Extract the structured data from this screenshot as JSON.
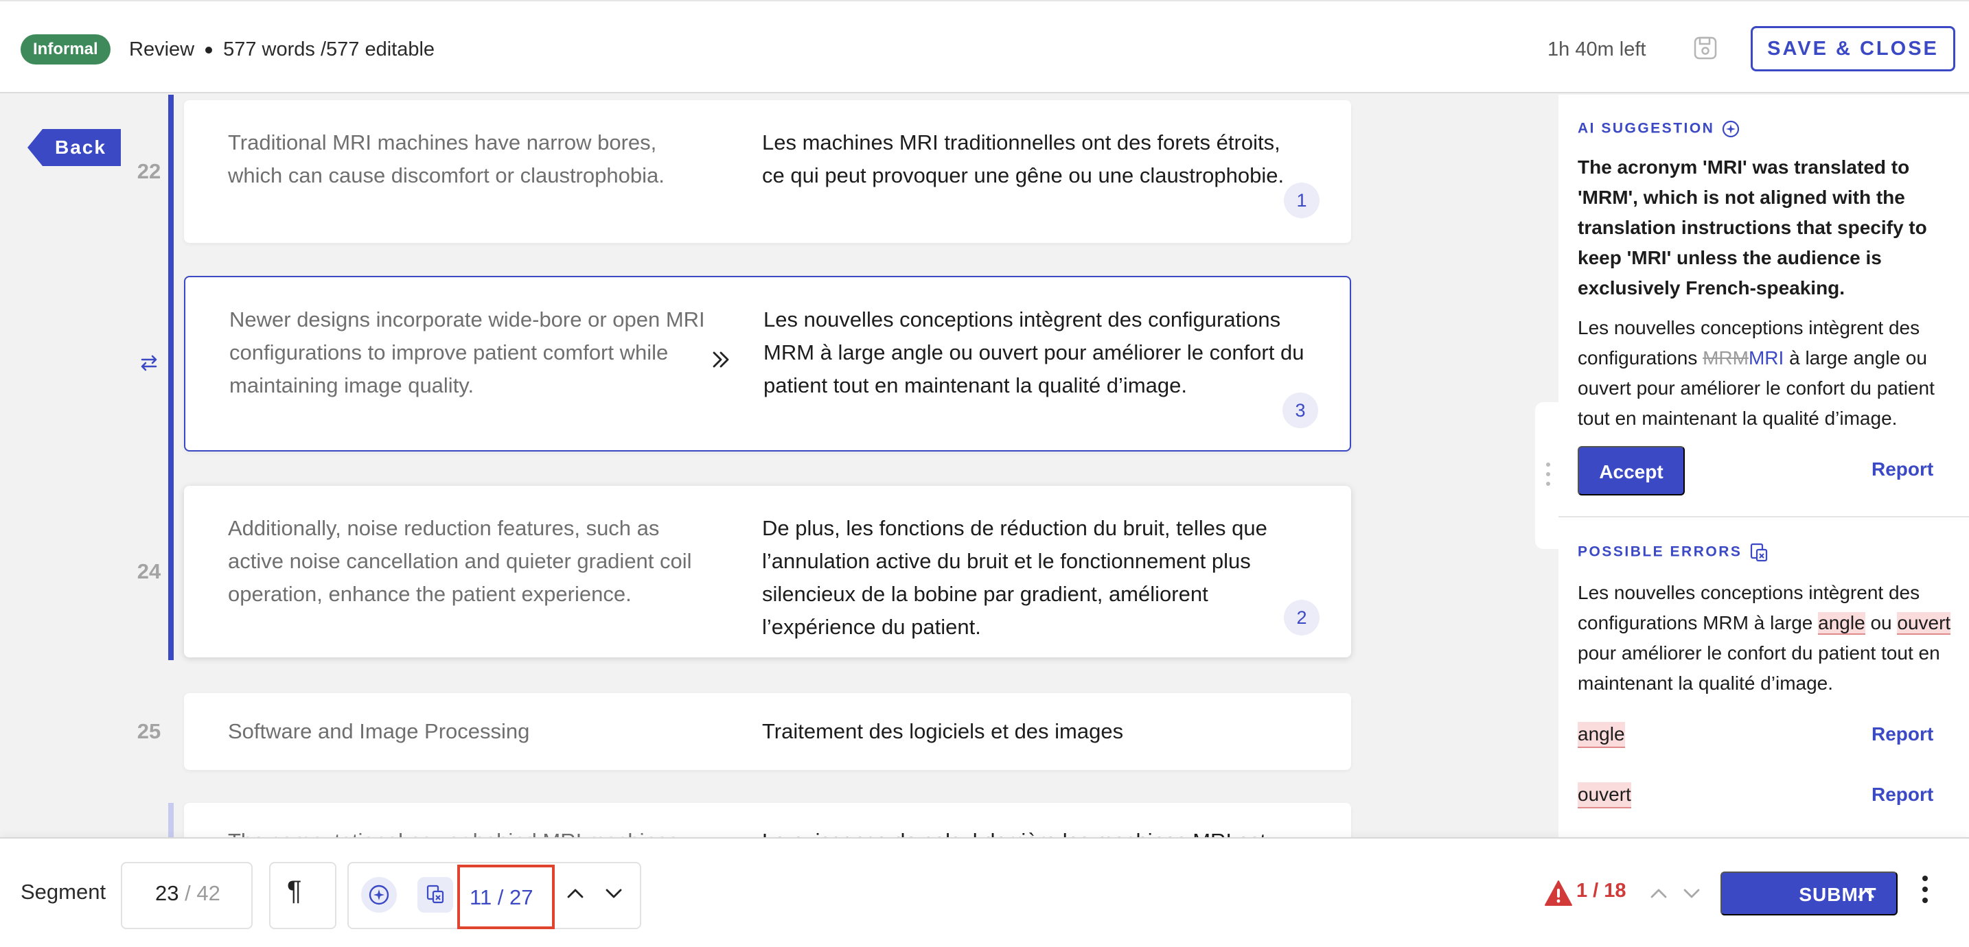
{
  "header": {
    "badge": "Informal",
    "mode": "Review",
    "word_count": "577 words /577 editable",
    "time_left": "1h 40m left",
    "save_close": "SAVE & CLOSE"
  },
  "nav": {
    "back": "Back"
  },
  "segments": [
    {
      "number": "22",
      "source": "Traditional MRI machines have narrow bores, which can cause discomfort or claustrophobia.",
      "target": "Les machines MRI traditionnelles ont des forets étroits, ce qui peut provoquer une gêne ou une claustrophobie.",
      "count": "1"
    },
    {
      "number": "",
      "source": "Newer designs incorporate wide-bore or open MRI configurations to improve patient comfort while maintaining image quality.",
      "target": "Les nouvelles conceptions intègrent des configurations MRM à large angle ou ouvert pour améliorer le confort du patient tout en maintenant la qualité d’image.",
      "count": "3"
    },
    {
      "number": "24",
      "source": "Additionally, noise reduction features, such as active noise cancellation and quieter gradient coil operation, enhance the patient experience.",
      "target": "De plus, les fonctions de réduction du bruit, telles que l’annulation active du bruit et le fonctionnement plus silencieux de la bobine par gradient, améliorent l’expérience du patient.",
      "count": "2"
    },
    {
      "number": "25",
      "source": "Software and Image Processing",
      "target": "Traitement des logiciels et des images",
      "count": ""
    },
    {
      "number": "",
      "source": "The computational power behind MRI machines",
      "target": "La puissance de calcul derrière les machines MRI est",
      "count": ""
    }
  ],
  "ai_suggestion": {
    "label": "AI SUGGESTION",
    "explanation": "The acronym 'MRI' was translated to 'MRM', which is not aligned with the translation instructions that specify to keep 'MRI' unless the audience is exclusively French-speaking.",
    "text_before": "Les nouvelles conceptions intègrent des configurations ",
    "deleted": "MRM",
    "inserted": "MRI",
    "text_after": " à large angle ou ouvert pour améliorer le confort du patient tout en maintenant la qualité d’image.",
    "accept": "Accept",
    "report": "Report"
  },
  "possible_errors": {
    "label": "POSSIBLE ERRORS",
    "text_1": "Les nouvelles conceptions intègrent des configurations MRM à large ",
    "word_1": "angle",
    "text_2": " ou ",
    "word_2": "ouvert",
    "text_3": " pour améliorer le confort du patient tout en maintenant la qualité d’image.",
    "items": [
      {
        "word": "angle",
        "report": "Report"
      },
      {
        "word": "ouvert",
        "report": "Report"
      }
    ]
  },
  "footer": {
    "segment_label": "Segment",
    "segment_current": "23",
    "segment_separator": "/",
    "segment_total": "42",
    "pilcrow": "¶",
    "error_nav": "11  /  27",
    "warning_count": "1 / 18",
    "submit": "SUBMIT"
  },
  "colors": {
    "accent": "#3b49c4",
    "badge_green": "#3e8a5b",
    "error_red": "#d23a3a",
    "highlight_pink": "#fbdcdc"
  },
  "icons": [
    "save-icon",
    "swap-icon",
    "double-chevron-right-icon",
    "ai-sparkle-icon",
    "error-doc-icon",
    "chevron-up-icon",
    "chevron-down-icon",
    "warning-icon",
    "kebab-icon"
  ]
}
